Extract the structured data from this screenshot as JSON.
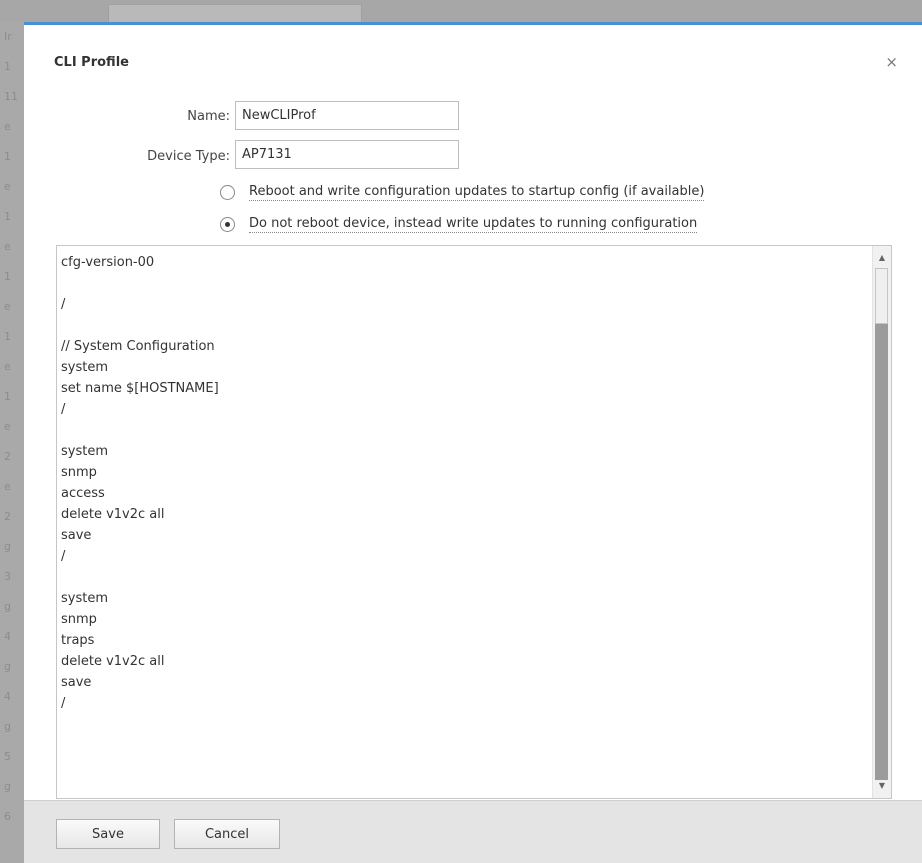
{
  "dialog": {
    "title": "CLI Profile",
    "close_glyph": "×"
  },
  "form": {
    "name_label": "Name:",
    "name_value": "NewCLIProf",
    "device_type_label": "Device Type:",
    "device_type_value": "AP7131"
  },
  "options": [
    {
      "label": "Reboot and write configuration updates to startup config (if available)",
      "checked": false
    },
    {
      "label": "Do not reboot device, instead write updates to running configuration",
      "checked": true
    }
  ],
  "script_text": "cfg-version-00\n\n/\n\n// System Configuration\nsystem\nset name $[HOSTNAME]\n/\n\nsystem\nsnmp\naccess\ndelete v1v2c all\nsave\n/\n\nsystem\nsnmp\ntraps\ndelete v1v2c all\nsave\n/",
  "footer": {
    "save_label": "Save",
    "cancel_label": "Cancel"
  },
  "background": {
    "side_glyphs": [
      "Ir",
      "1",
      "11",
      "e",
      "1",
      "e",
      "1",
      "e",
      "1",
      "e",
      "1",
      "e",
      "1",
      "e",
      "2",
      "e",
      "2",
      "g",
      "3",
      "g",
      "4",
      "g",
      "4",
      "g",
      "5",
      "g",
      "6"
    ]
  },
  "colors": {
    "accent": "#4a8fd4",
    "footer_bg": "#e4e4e4",
    "overlay": "#9a9a9a"
  }
}
